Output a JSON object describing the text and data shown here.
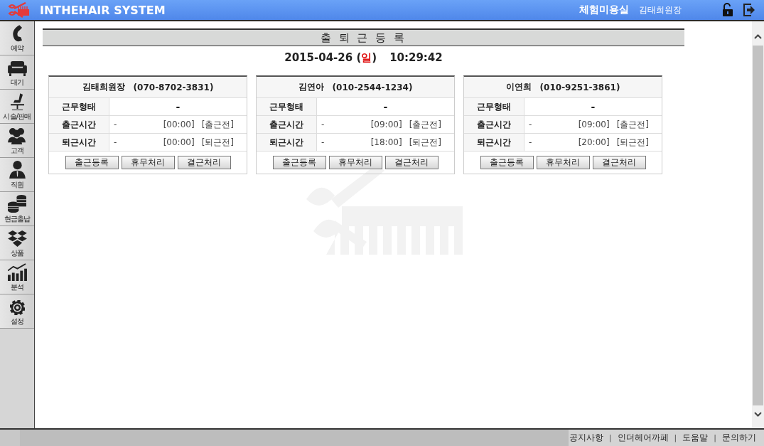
{
  "header": {
    "app_title": "INTHEHAIR SYSTEM",
    "shop_name": "체험미용실",
    "user_name": "김태희원장"
  },
  "sidebar": {
    "items": [
      {
        "kind": "phone",
        "label": "예약"
      },
      {
        "kind": "sofa",
        "label": "대기"
      },
      {
        "kind": "chair",
        "label": "시술/판매"
      },
      {
        "kind": "people",
        "label": "고객"
      },
      {
        "kind": "person",
        "label": "직원"
      },
      {
        "kind": "coins",
        "label": "현금출납"
      },
      {
        "kind": "boxes",
        "label": "상품"
      },
      {
        "kind": "chart",
        "label": "분석"
      },
      {
        "kind": "gear",
        "label": "설정"
      }
    ]
  },
  "page": {
    "title": "출 퇴 근 등 록",
    "date": "2015-04-26",
    "weekday_open": "(",
    "weekday": "일",
    "weekday_close": ")",
    "time": "10:29:42"
  },
  "cards": [
    {
      "name": "김태희원장",
      "phone": "(070-8702-3831)",
      "rows": [
        {
          "kind": "plain",
          "label": "근무형태",
          "value": "-"
        },
        {
          "kind": "time",
          "label": "출근시간",
          "value": "-",
          "time": "[00:00]",
          "status": "[출근전]"
        },
        {
          "kind": "time",
          "label": "퇴근시간",
          "value": "-",
          "time": "[00:00]",
          "status": "[퇴근전]"
        }
      ],
      "buttons": [
        "출근등록",
        "휴무처리",
        "결근처리"
      ]
    },
    {
      "name": "김연아",
      "phone": "(010-2544-1234)",
      "rows": [
        {
          "kind": "plain",
          "label": "근무형태",
          "value": "-"
        },
        {
          "kind": "time",
          "label": "출근시간",
          "value": "-",
          "time": "[09:00]",
          "status": "[출근전]"
        },
        {
          "kind": "time",
          "label": "퇴근시간",
          "value": "-",
          "time": "[18:00]",
          "status": "[퇴근전]"
        }
      ],
      "buttons": [
        "출근등록",
        "휴무처리",
        "결근처리"
      ]
    },
    {
      "name": "이연희",
      "phone": "(010-9251-3861)",
      "rows": [
        {
          "kind": "plain",
          "label": "근무형태",
          "value": "-"
        },
        {
          "kind": "time",
          "label": "출근시간",
          "value": "-",
          "time": "[09:00]",
          "status": "[출근전]"
        },
        {
          "kind": "time",
          "label": "퇴근시간",
          "value": "-",
          "time": "[20:00]",
          "status": "[퇴근전]"
        }
      ],
      "buttons": [
        "출근등록",
        "휴무처리",
        "결근처리"
      ]
    }
  ],
  "footer": {
    "items": [
      {
        "kind": "link",
        "text": "공지사항"
      },
      {
        "kind": "separator",
        "text": "|"
      },
      {
        "kind": "link",
        "text": "인더헤어까페"
      },
      {
        "kind": "separator",
        "text": "|"
      },
      {
        "kind": "link",
        "text": "도움말"
      },
      {
        "kind": "separator",
        "text": "|"
      },
      {
        "kind": "link",
        "text": "문의하기"
      }
    ]
  }
}
